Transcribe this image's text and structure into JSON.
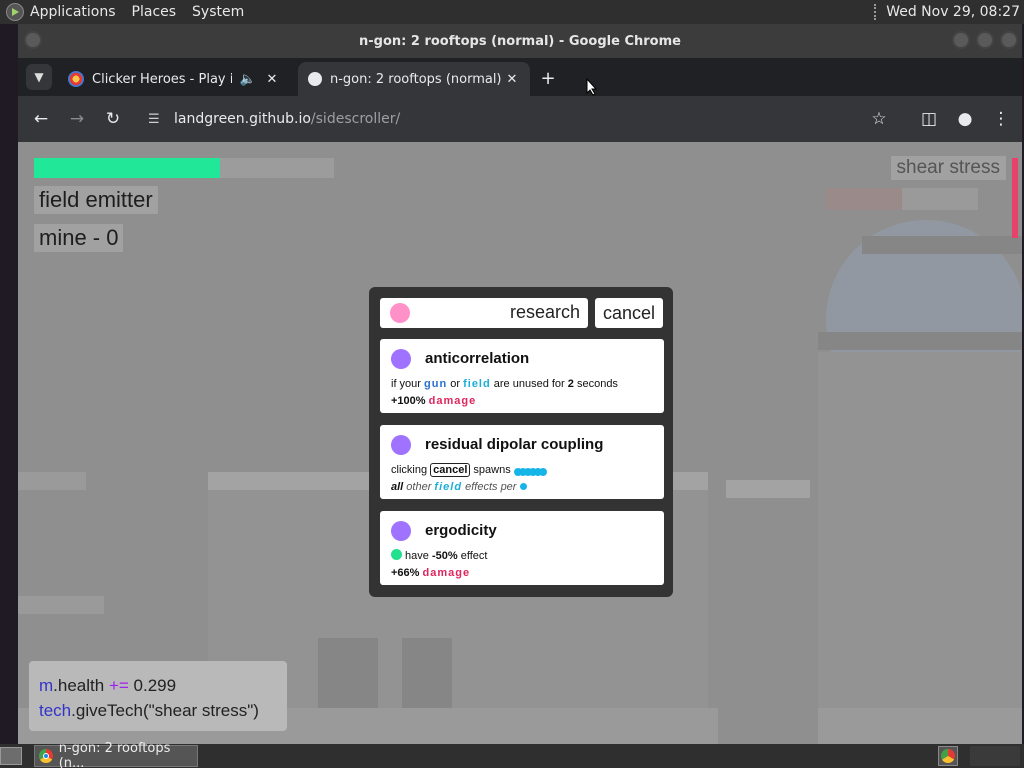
{
  "os": {
    "top_menu": [
      "Applications",
      "Places",
      "System"
    ],
    "clock": "Wed Nov 29, 08:27",
    "taskbar_item": "n-gon: 2 rooftops (n..."
  },
  "window": {
    "title": "n-gon: 2 rooftops (normal) - Google Chrome"
  },
  "tabs": [
    {
      "title": "Clicker Heroes - Play it now",
      "audio_icon": "speaker-icon",
      "active": false
    },
    {
      "title": "n-gon: 2 rooftops (normal)",
      "active": true
    }
  ],
  "toolbar": {
    "url_host": "landgreen.github.io",
    "url_path": "/sidescroller/"
  },
  "game": {
    "health_fraction": 0.62,
    "health_color": "#21e898",
    "field_label": "field emitter",
    "mine_label": "mine - 0",
    "tech_label": "shear stress",
    "tech_bar_color": "#e8426b",
    "console": {
      "line1_obj": "m",
      "line1_prop": ".health",
      "line1_op": "+=",
      "line1_val": "0.299",
      "line2_obj": "tech",
      "line2_call": ".giveTech(\"",
      "line2_arg": "shear stress",
      "line2_end": "\")"
    }
  },
  "modal": {
    "research_label": "research",
    "cancel_label": "cancel",
    "research_dot_color": "#ff91c8",
    "tech_dot_color": "#9f72ff",
    "cards": [
      {
        "name": "anticorrelation",
        "d1_a": "if your ",
        "d1_gun": "gun",
        "d1_b": " or ",
        "d1_field": "field",
        "d1_c": " are unused for ",
        "d1_num": "2",
        "d1_d": " seconds",
        "d2_pct": "+100%",
        "d2_dmg": "damage"
      },
      {
        "name": "residual dipolar coupling",
        "d1_a": "clicking ",
        "d1_kbd": "cancel",
        "d1_b": " spawns ",
        "d2_all": "all",
        "d2_a": " other ",
        "d2_field": "field",
        "d2_b": " effects per "
      },
      {
        "name": "ergodicity",
        "d1_a": " have ",
        "d1_num": "-50%",
        "d1_b": " effect",
        "d2_pct": "+66%",
        "d2_dmg": "damage"
      }
    ]
  }
}
